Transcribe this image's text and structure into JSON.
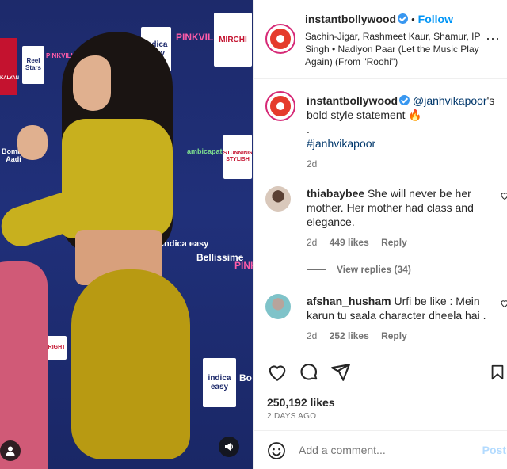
{
  "media": {
    "backdrop_logos": [
      "indica easy",
      "PINKVILLA",
      "MIRCHI",
      "KALYAN",
      "Reel Stars",
      "PINKVILLA",
      "Bombay Aadi",
      "ambicapatel",
      "STUNNING STYLISH",
      "indica easy",
      "Bellissime",
      "PINK",
      "BRIGHT",
      "indica easy",
      "Bo"
    ],
    "mute_icon": "speaker-icon",
    "user_icon": "person-icon"
  },
  "header": {
    "username": "instantbollywood",
    "dot": "•",
    "follow_label": "Follow",
    "audio": "Sachin-Jigar, Rashmeet Kaur, Shamur, IP Singh • Nadiyon Paar (Let the Music Play Again) (From \"Roohi\")",
    "more_label": "···"
  },
  "caption": {
    "username": "instantbollywood",
    "mention": "@janhvikapoor",
    "text": "'s bold style statement 🔥",
    "dot_line": ".",
    "hashtag": "#janhvikapoor",
    "time": "2d"
  },
  "comments": [
    {
      "username": "thiabaybee",
      "text": "She will never be her mother. Her mother had class and elegance.",
      "time": "2d",
      "likes": "449 likes",
      "reply_label": "Reply"
    },
    {
      "username": "afshan_husham",
      "text": "Urfi be like : Mein karun tu saala character dheela hai .",
      "time": "2d",
      "likes": "252 likes",
      "reply_label": "Reply"
    }
  ],
  "view_replies_label": "View replies (34)",
  "actions": {
    "likes": "250,192 likes",
    "date": "2 DAYS AGO"
  },
  "add_comment": {
    "placeholder": "Add a comment...",
    "post_label": "Post"
  },
  "colors": {
    "accent": "#0095f6",
    "verified": "#3897f0",
    "post_disabled": "#b3dbff"
  }
}
